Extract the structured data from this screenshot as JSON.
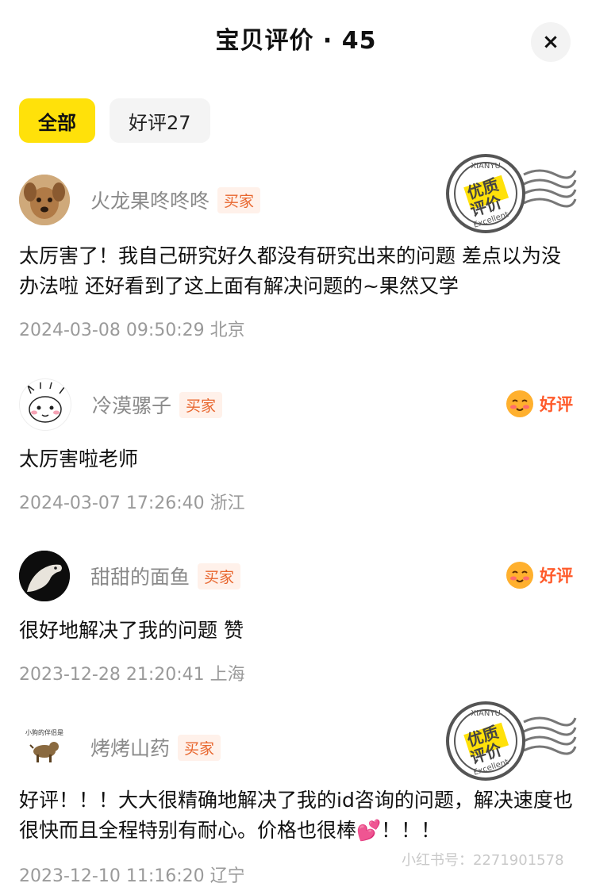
{
  "header": {
    "title": "宝贝评价 · 45",
    "close_icon": "×"
  },
  "tabs": [
    {
      "label": "全部",
      "active": true
    },
    {
      "label": "好评27",
      "active": false
    }
  ],
  "reviews": [
    {
      "username": "火龙果咚咚咚",
      "badge": "买家",
      "good_label": "",
      "text": "太厉害了！我自己研究好久都没有研究出来的问题 差点以为没办法啦 还好看到了这上面有解决问题的~果然又学",
      "time": "2024-03-08 09:50:29 北京",
      "stamp": {
        "top": "XIANYU",
        "main1": "优质",
        "main2": "评价",
        "bottom": "Excellent"
      }
    },
    {
      "username": "冷漠骡子",
      "badge": "买家",
      "good_label": "好评",
      "text": "太厉害啦老师",
      "time": "2024-03-07 17:26:40 浙江"
    },
    {
      "username": "甜甜的面鱼",
      "badge": "买家",
      "good_label": "好评",
      "text": "很好地解决了我的问题 赞",
      "time": "2023-12-28 21:20:41 上海"
    },
    {
      "username": "烤烤山药",
      "badge": "买家",
      "good_label": "",
      "text": "好评！！！大大很精确地解决了我的id咨询的问题，解决速度也很快而且全程特别有耐心。价格也很棒💕！！！",
      "time": "2023-12-10 11:16:20 辽宁",
      "avatar_caption": "小狗的伴侣是",
      "stamp": {
        "top": "XIANYU",
        "main1": "优质",
        "main2": "评价",
        "bottom": "Excellent"
      }
    }
  ],
  "watermark": "小红书号：2271901578",
  "colors": {
    "accent": "#ffe10a",
    "badge": "#e8672f",
    "good": "#ff5a2a"
  }
}
